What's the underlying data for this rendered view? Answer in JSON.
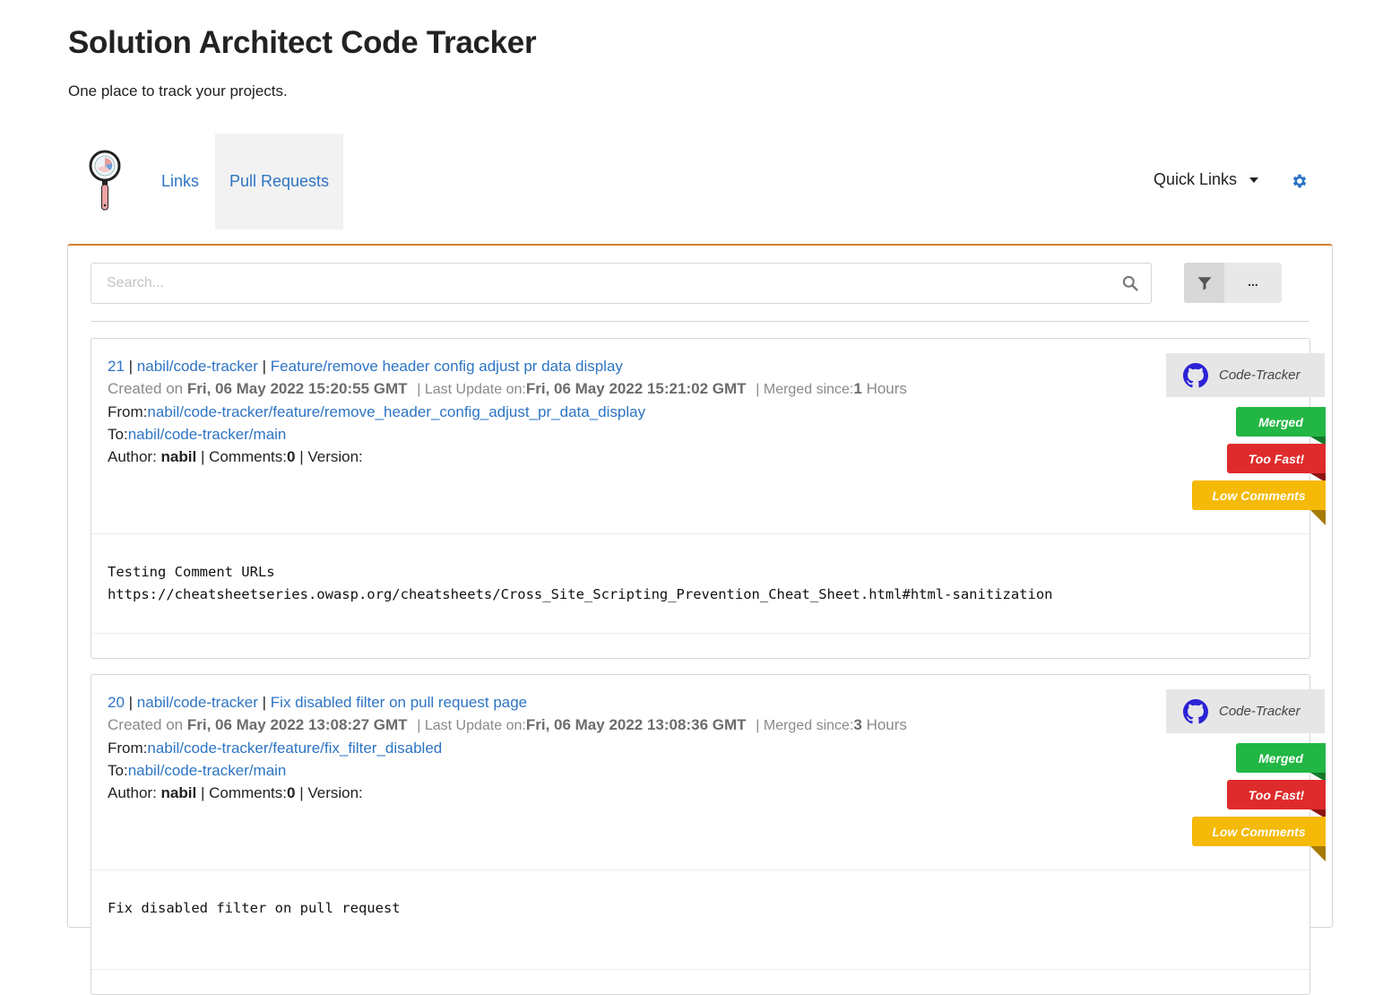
{
  "header": {
    "title": "Solution Architect Code Tracker",
    "subtitle": "One place to track your projects."
  },
  "nav": {
    "links_label": "Links",
    "pull_requests_label": "Pull Requests",
    "quick_links_label": "Quick Links",
    "active_tab": "Pull Requests"
  },
  "search": {
    "placeholder": "Search...",
    "more_label": "..."
  },
  "colors": {
    "accent": "#d3812e",
    "link": "#2d74c4",
    "merged": "#22b644",
    "too_fast": "#df2b2b",
    "low_comments": "#f5b907"
  },
  "pull_requests": [
    {
      "number": "21",
      "repo": "nabil/code-tracker",
      "title": "Feature/remove header config adjust pr data display",
      "created_label": "Created on ",
      "created": "Fri, 06 May 2022 15:20:55 GMT",
      "updated_label": "| Last Update on:",
      "updated": "Fri, 06 May 2022 15:21:02 GMT",
      "merged_label": "| Merged since:",
      "merged_value": "1",
      "merged_unit": "Hours",
      "from_label": "From:",
      "from": "nabil/code-tracker/feature/remove_header_config_adjust_pr_data_display",
      "to_label": "To:",
      "to": "nabil/code-tracker/main",
      "author_label": "Author: ",
      "author": "nabil",
      "comments_label": "| Comments:",
      "comments": "0",
      "version_label": "| Version:",
      "description": "Testing Comment URLs\nhttps://cheatsheetseries.owasp.org/cheatsheets/Cross_Site_Scripting_Prevention_Cheat_Sheet.html#html-sanitization",
      "repo_tag": "Code-Tracker",
      "tags": [
        "Merged",
        "Too Fast!",
        "Low Comments"
      ]
    },
    {
      "number": "20",
      "repo": "nabil/code-tracker",
      "title": "Fix disabled filter on pull request page",
      "created_label": "Created on ",
      "created": "Fri, 06 May 2022 13:08:27 GMT",
      "updated_label": "| Last Update on:",
      "updated": "Fri, 06 May 2022 13:08:36 GMT",
      "merged_label": "| Merged since:",
      "merged_value": "3",
      "merged_unit": "Hours",
      "from_label": "From:",
      "from": "nabil/code-tracker/feature/fix_filter_disabled",
      "to_label": "To:",
      "to": "nabil/code-tracker/main",
      "author_label": "Author: ",
      "author": "nabil",
      "comments_label": "| Comments:",
      "comments": "0",
      "version_label": "| Version:",
      "description": "Fix disabled filter on pull request",
      "repo_tag": "Code-Tracker",
      "tags": [
        "Merged",
        "Too Fast!",
        "Low Comments"
      ]
    }
  ]
}
